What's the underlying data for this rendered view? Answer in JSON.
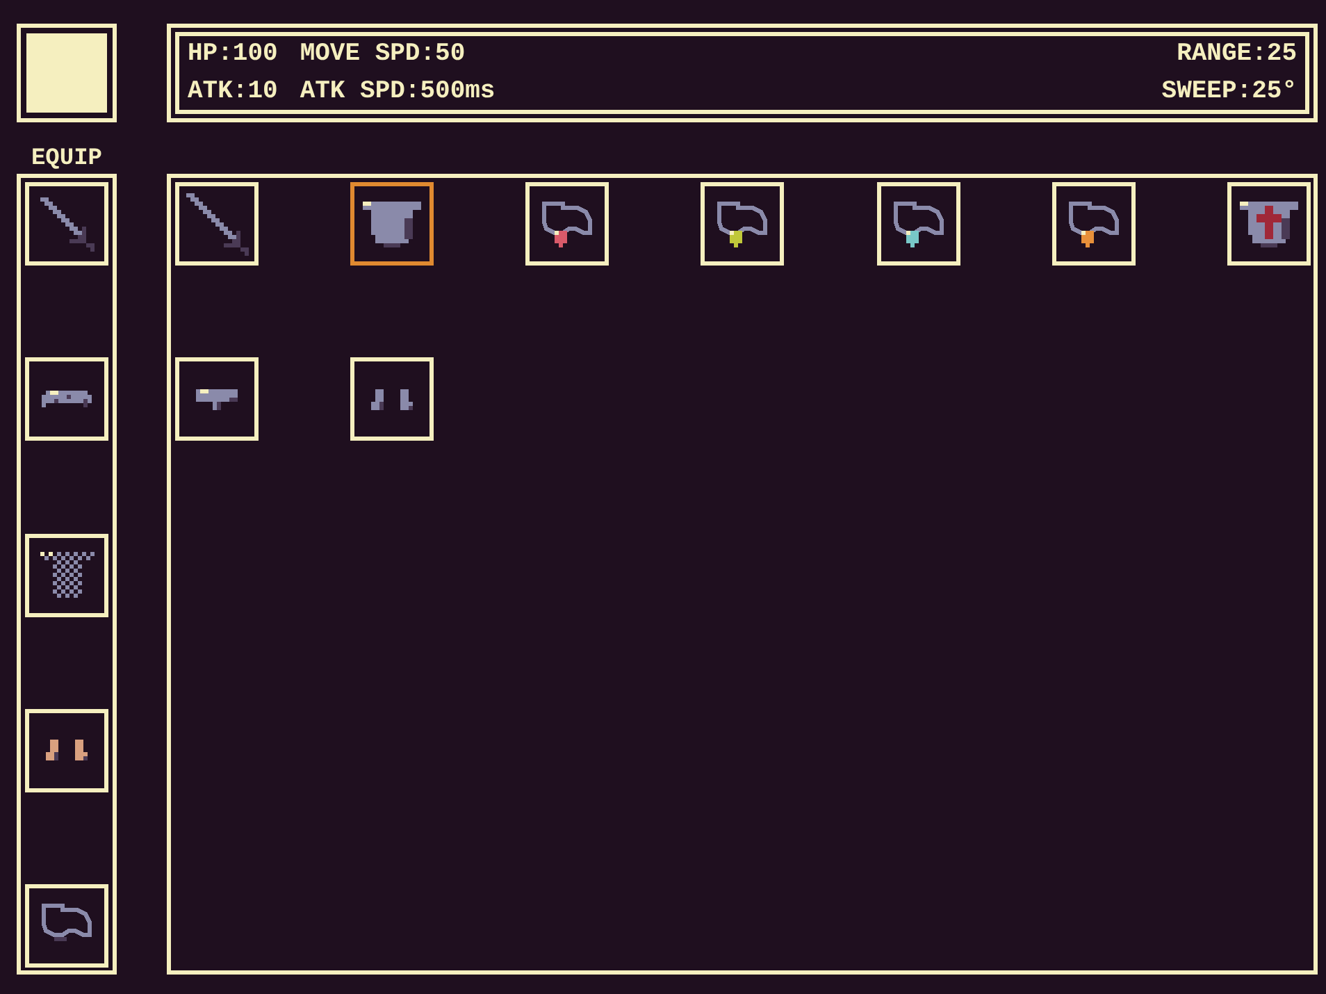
{
  "stats": {
    "rows": [
      {
        "left": [
          "HP:100",
          "MOVE SPD:50"
        ],
        "right": "RANGE:25"
      },
      {
        "left": [
          "ATK:10",
          "ATK SPD:500ms"
        ],
        "right": "SWEEP:25°"
      }
    ]
  },
  "equip": {
    "title": "EQUIP",
    "slots": [
      {
        "kind": "dagger"
      },
      {
        "kind": "helmet"
      },
      {
        "kind": "chainmail"
      },
      {
        "kind": "boots",
        "color": "#d9a07f"
      },
      {
        "kind": "necklace"
      }
    ]
  },
  "inventory": {
    "items": [
      {
        "kind": "sword",
        "selected": false
      },
      {
        "kind": "armor",
        "selected": true
      },
      {
        "kind": "necklace",
        "color": "#d95a6a",
        "selected": false
      },
      {
        "kind": "necklace",
        "color": "#c0c83a",
        "selected": false
      },
      {
        "kind": "necklace",
        "color": "#78c8c8",
        "selected": false
      },
      {
        "kind": "necklace",
        "color": "#e8903a",
        "selected": false
      },
      {
        "kind": "crest_armor",
        "color": "#a02838",
        "selected": false
      },
      {
        "kind": "hat",
        "selected": false
      },
      {
        "kind": "boots",
        "color": "#8a8aaa",
        "selected": false
      }
    ]
  }
}
